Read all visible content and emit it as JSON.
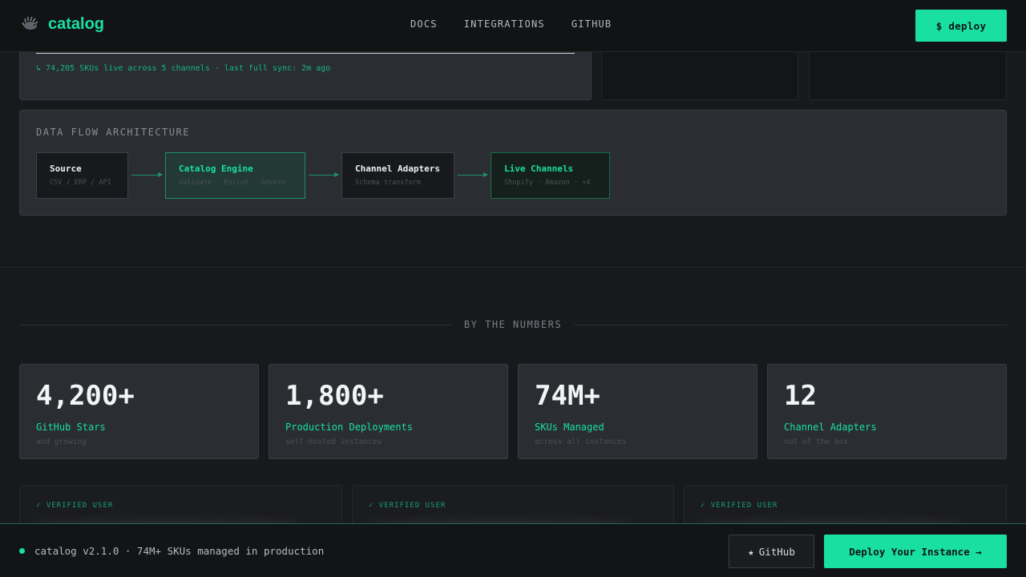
{
  "header": {
    "logo_text": "catalog",
    "nav": [
      "DOCS",
      "INTEGRATIONS",
      "GITHUB"
    ],
    "deploy_label": "$ deploy"
  },
  "sync": {
    "text": "↳ 74,205 SKUs live across 5 channels · last full sync: 2m ago"
  },
  "architecture": {
    "title": "DATA FLOW ARCHITECTURE",
    "nodes": [
      {
        "title": "Source",
        "sub": "CSV / ERP / API"
      },
      {
        "title": "Catalog Engine",
        "sub": "Validate · Enrich · Govern"
      },
      {
        "title": "Channel Adapters",
        "sub": "Schema transform"
      },
      {
        "title": "Live Channels",
        "sub": "Shopify · Amazon · +4"
      }
    ]
  },
  "numbers": {
    "title": "BY THE NUMBERS",
    "stats": [
      {
        "value": "4,200+",
        "label": "GitHub Stars",
        "sub": "and growing"
      },
      {
        "value": "1,800+",
        "label": "Production Deployments",
        "sub": "self-hosted instances"
      },
      {
        "value": "74M+",
        "label": "SKUs Managed",
        "sub": "across all instances"
      },
      {
        "value": "12",
        "label": "Channel Adapters",
        "sub": "out of the box"
      }
    ]
  },
  "testimonials": [
    {
      "badge": "✓ VERIFIED USER"
    },
    {
      "badge": "✓ VERIFIED USER"
    },
    {
      "badge": "✓ VERIFIED USER"
    }
  ],
  "footer": {
    "status_text": "catalog v2.1.0 · 74M+ SKUs managed in production",
    "github_label": "GitHub",
    "github_icon": "★",
    "deploy_label": "Deploy Your Instance →"
  },
  "colors": {
    "accent": "#19e0a0",
    "background": "#18191c",
    "card": "#2a2d32"
  }
}
